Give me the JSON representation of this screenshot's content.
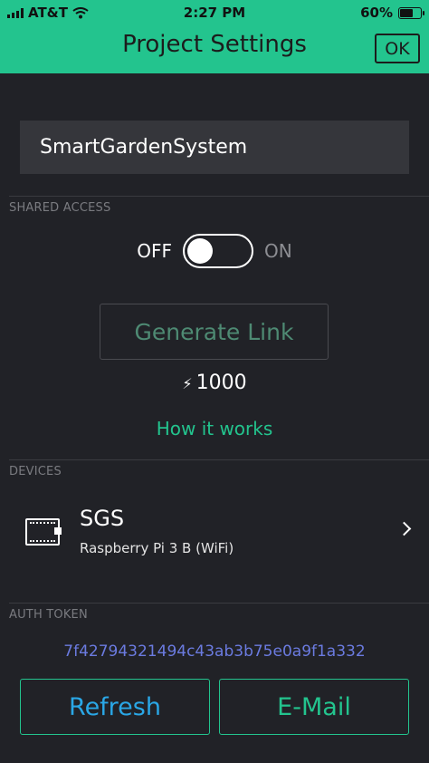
{
  "status_bar": {
    "carrier": "AT&T",
    "time": "2:27 PM",
    "battery": "60%"
  },
  "header": {
    "title": "Project Settings",
    "ok_label": "OK"
  },
  "project": {
    "name": "SmartGardenSystem"
  },
  "shared_access": {
    "section_label": "SHARED ACCESS",
    "off_label": "OFF",
    "on_label": "ON",
    "enabled": false,
    "generate_link_label": "Generate Link",
    "energy_cost": "1000",
    "how_it_works_label": "How it works"
  },
  "devices": {
    "section_label": "DEVICES",
    "items": [
      {
        "name": "SGS",
        "type": "Raspberry Pi 3 B (WiFi)",
        "icon": "board-icon"
      }
    ]
  },
  "auth": {
    "section_label": "AUTH TOKEN",
    "token": "7f42794321494c43ab3b75e0a9f1a332"
  },
  "actions": {
    "refresh_label": "Refresh",
    "email_label": "E-Mail"
  },
  "colors": {
    "accent_green": "#23c48e",
    "background": "#212227",
    "token_blue": "#6b7be0",
    "refresh_blue": "#2aa7e6"
  }
}
